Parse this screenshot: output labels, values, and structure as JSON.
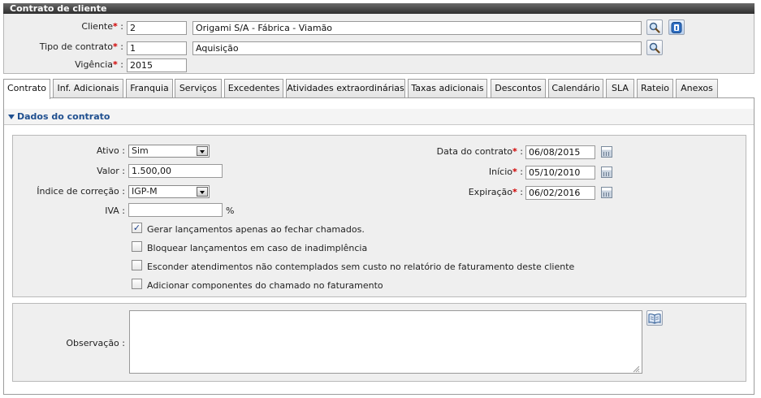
{
  "panel": {
    "title": "Contrato de cliente"
  },
  "header": {
    "cliente": {
      "label": "Cliente",
      "code": "2",
      "name": "Origami S/A - Fábrica - Viamão"
    },
    "tipo_contrato": {
      "label": "Tipo de contrato",
      "code": "1",
      "name": "Aquisição"
    },
    "vigencia": {
      "label": "Vigência",
      "value": "2015"
    },
    "colon": ":",
    "required_mark": "*"
  },
  "tabs": [
    {
      "label": "Contrato",
      "active": true
    },
    {
      "label": "Inf. Adicionais"
    },
    {
      "label": "Franquia"
    },
    {
      "label": "Serviços"
    },
    {
      "label": "Excedentes"
    },
    {
      "label": "Atividades extraordinárias"
    },
    {
      "label": "Taxas adicionais"
    },
    {
      "label": "Descontos"
    },
    {
      "label": "Calendário"
    },
    {
      "label": "SLA"
    },
    {
      "label": "Rateio"
    },
    {
      "label": "Anexos"
    }
  ],
  "section": {
    "title": "Dados do contrato"
  },
  "form": {
    "ativo": {
      "label": "Ativo :",
      "value": "Sim"
    },
    "valor": {
      "label": "Valor :",
      "value": "1.500,00"
    },
    "indice": {
      "label": "Índice de correção :",
      "value": "IGP-M"
    },
    "iva": {
      "label": "IVA :",
      "value": "",
      "unit": "%"
    },
    "data_contrato": {
      "label": "Data do contrato",
      "value": "06/08/2015"
    },
    "inicio": {
      "label": "Início",
      "value": "05/10/2010"
    },
    "expiracao": {
      "label": "Expiração",
      "value": "06/02/2016"
    },
    "checkboxes": [
      {
        "label": "Gerar lançamentos apenas ao fechar chamados.",
        "checked": true
      },
      {
        "label": "Bloquear lançamentos em caso de inadimplência",
        "checked": false
      },
      {
        "label": "Esconder atendimentos não contemplados sem custo no relatório de faturamento deste cliente",
        "checked": false
      },
      {
        "label": "Adicionar componentes do chamado no faturamento",
        "checked": false
      }
    ],
    "observacao": {
      "label": "Observação :",
      "value": ""
    }
  },
  "icons": {
    "search": "search-icon",
    "info": "info-icon",
    "calendar": "calendar-icon",
    "book": "book-icon",
    "section_toggle": "triangle-down-icon"
  },
  "colors": {
    "accent": "#1f4f8f",
    "required": "#d10000",
    "panel_header": "#3a3a3a"
  }
}
